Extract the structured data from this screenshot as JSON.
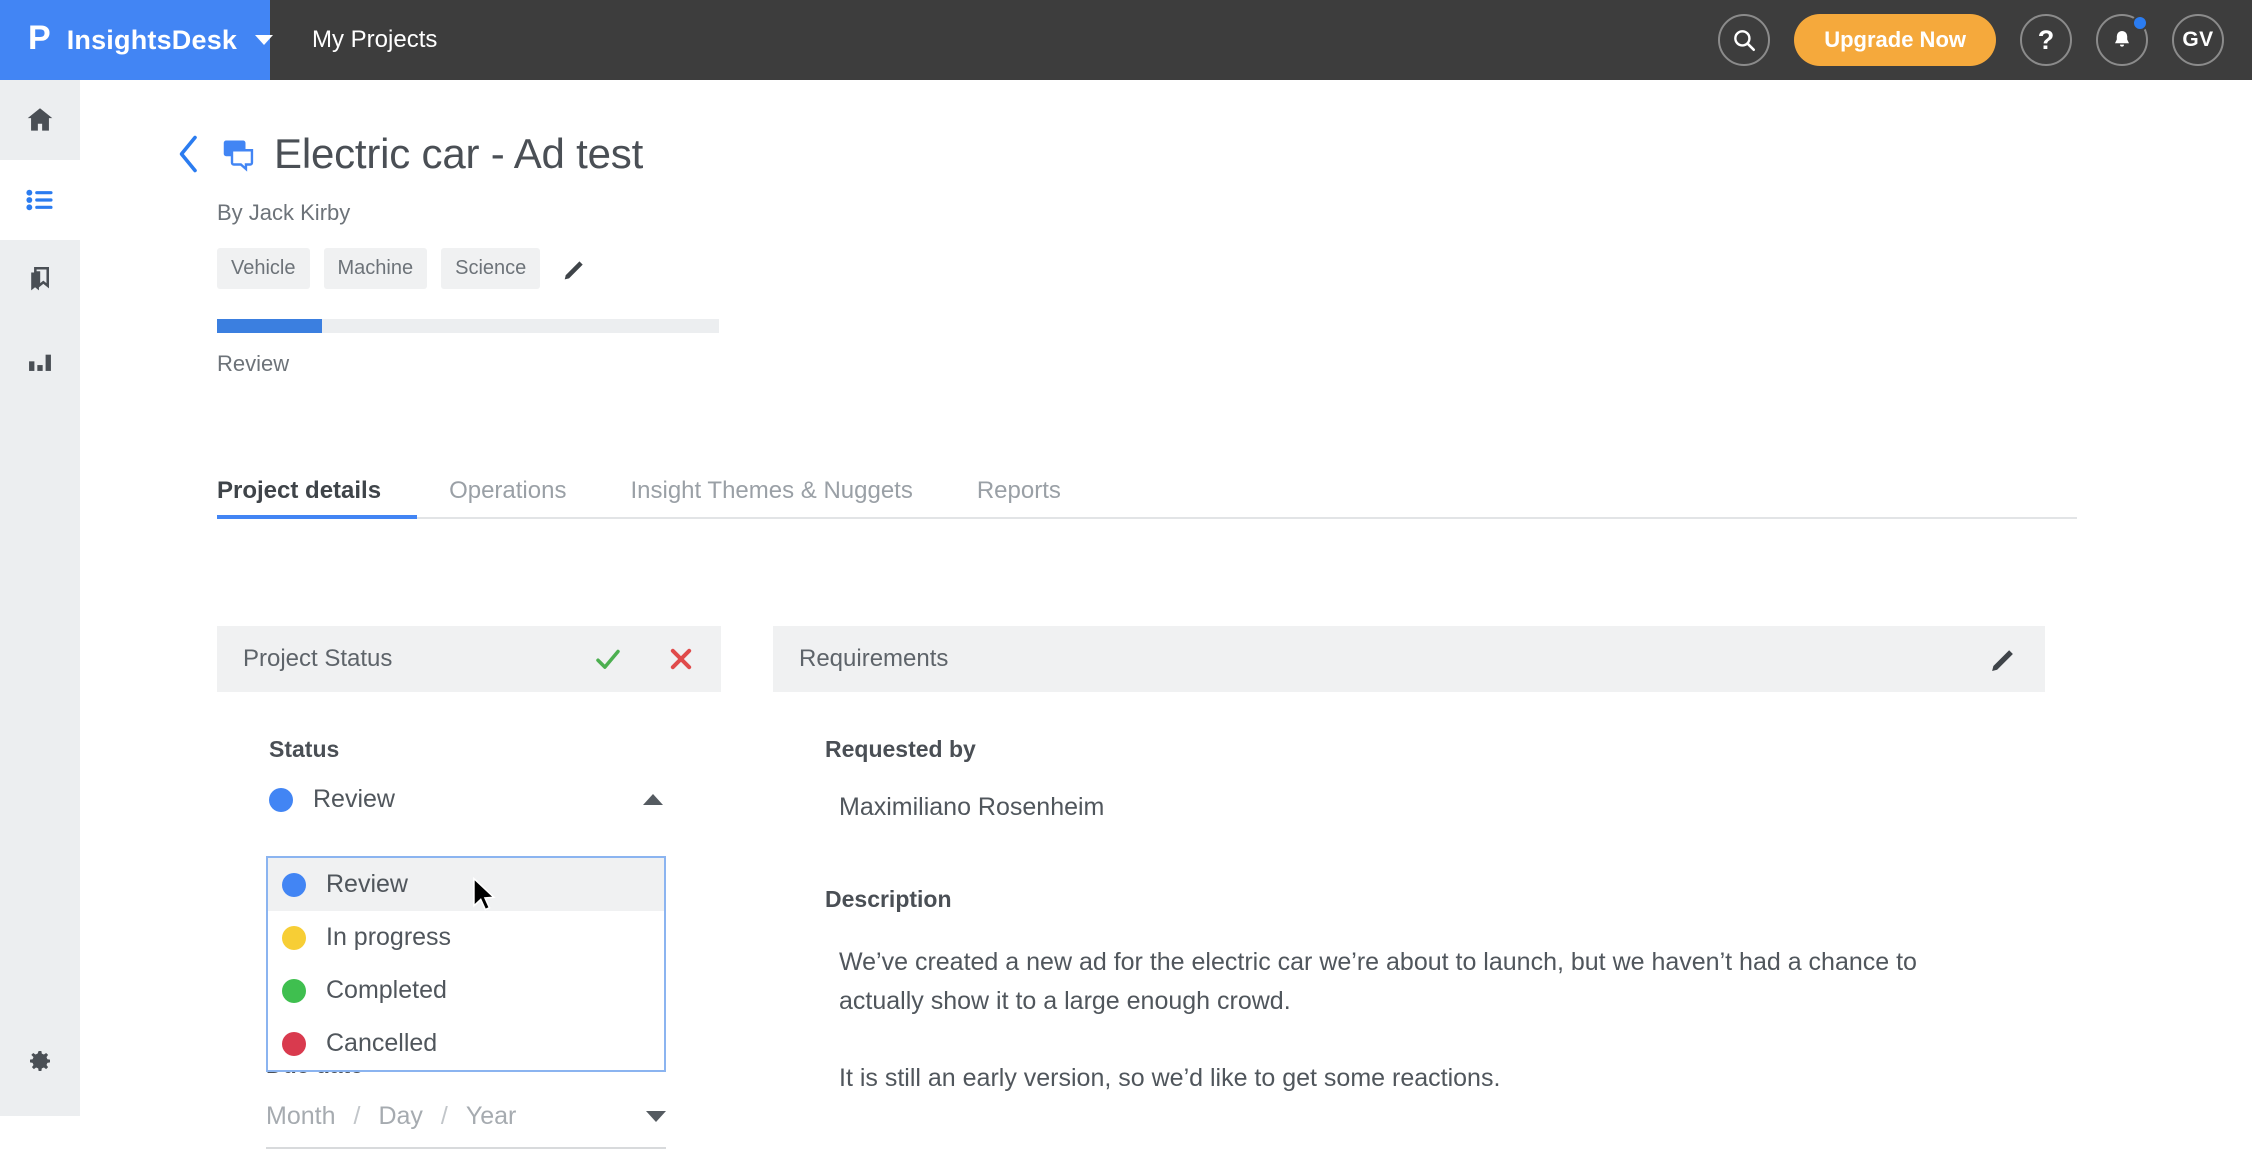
{
  "topbar": {
    "logo_glyph": "P",
    "brand": "InsightsDesk",
    "nav_link": "My Projects",
    "upgrade_label": "Upgrade Now",
    "help_label": "?",
    "avatar_initials": "GV"
  },
  "sidebar": {
    "items": [
      {
        "name": "home-icon",
        "active": false
      },
      {
        "name": "list-icon",
        "active": true
      },
      {
        "name": "bookmark-icon",
        "active": false
      },
      {
        "name": "chart-icon",
        "active": false
      }
    ],
    "bottom": {
      "name": "gear-icon"
    }
  },
  "page": {
    "title": "Electric car - Ad test",
    "byline": "By Jack Kirby",
    "tags": [
      "Vehicle",
      "Machine",
      "Science"
    ],
    "progress_label": "Review",
    "progress_percent": 21
  },
  "tabs": [
    {
      "label": "Project details",
      "active": true
    },
    {
      "label": "Operations",
      "active": false
    },
    {
      "label": "Insight Themes & Nuggets",
      "active": false
    },
    {
      "label": "Reports",
      "active": false
    }
  ],
  "project_status": {
    "card_title": "Project Status",
    "confirm_label": "✓",
    "cancel_label": "✕",
    "status_label": "Status",
    "status_value": "Review",
    "status_color": "#4285f4",
    "options": [
      {
        "label": "Review",
        "color": "#4285f4",
        "hovered": true
      },
      {
        "label": "In progress",
        "color": "#f7ce35",
        "hovered": false
      },
      {
        "label": "Completed",
        "color": "#3fbf4f",
        "hovered": false
      },
      {
        "label": "Cancelled",
        "color": "#d93a4e",
        "hovered": false
      }
    ],
    "due_date_label": "Due date",
    "date_month_placeholder": "Month",
    "date_day_placeholder": "Day",
    "date_year_placeholder": "Year",
    "date_separator": "/"
  },
  "requirements": {
    "card_title": "Requirements",
    "requested_by_label": "Requested by",
    "requested_by_value": "Maximiliano Rosenheim",
    "description_label": "Description",
    "description_p1": "We’ve created a new ad for the electric car we’re about to launch, but we haven’t had a chance to actually show it to a large enough crowd.",
    "description_p2": "It is still an early version, so we’d like to get some reactions."
  },
  "colors": {
    "brand_blue": "#4285f4",
    "topbar_dark": "#3d3d3d",
    "upgrade_orange": "#f5a93c",
    "confirm_green": "#4caf50",
    "cancel_red": "#e04b4b"
  }
}
